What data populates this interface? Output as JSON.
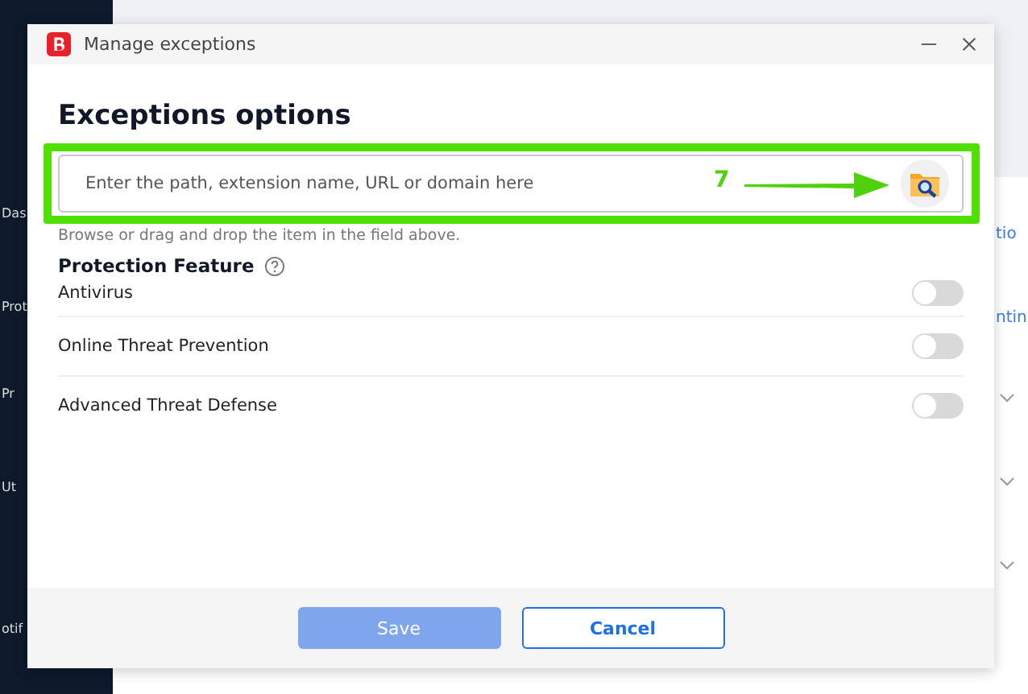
{
  "background_app": {
    "sidebar_items": [
      "Das",
      "Prot",
      "Pr",
      "Ut",
      "otif"
    ],
    "right_fragments": [
      "tio",
      "ntin"
    ]
  },
  "dialog": {
    "title": "Manage exceptions",
    "heading": "Exceptions options",
    "path_field": {
      "placeholder": "Enter the path, extension name, URL or domain here"
    },
    "hint": "Browse or drag and drop the item in the field above.",
    "section_title": "Protection Feature",
    "features": [
      {
        "label": "Antivirus",
        "on": false
      },
      {
        "label": "Online Threat Prevention",
        "on": false
      },
      {
        "label": "Advanced Threat Defense",
        "on": false
      }
    ],
    "buttons": [
      {
        "label": "Save",
        "disabled": true
      },
      {
        "label": "Cancel",
        "disabled": false
      }
    ]
  },
  "annotation": {
    "number": "7"
  }
}
